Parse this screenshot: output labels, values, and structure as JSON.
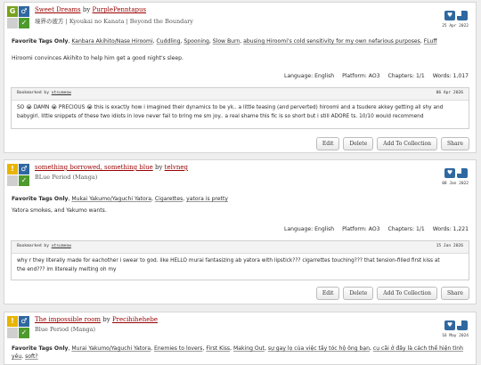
{
  "colors": {
    "rating_general": "#77a11e",
    "warning_yellow": "#e8b400",
    "category_blue": "#2f68a0",
    "complete_green": "#4e9b2d",
    "tr_blank": "#cfcfcf",
    "link": "#990000"
  },
  "works": [
    {
      "title": "Sweet Dreams",
      "by": "by",
      "author": "PurplePenntapus",
      "fandoms": "境界の彼方 | Kyoukai no Kanata | Beyond the Boundary",
      "date": "25 Apr 2022",
      "rating_symbol": "G",
      "category_symbol": "♂",
      "tags_label": "Favorite Tags Only",
      "tags": [
        "Kanbara Akihito/Nase Hiroomi",
        "Cuddling",
        "Spooning",
        "Slow Burn",
        "abusing Hiroomi's cold sensitivity for my own nefarious purposes",
        "FLuff"
      ],
      "summary": "Hiroomi convinces Akihito to help him get a good night's sleep.",
      "stats": {
        "language": "Language: English",
        "platform": "Platform: AO3",
        "chapters": "Chapters: 1/1",
        "words": "Words: 1,017"
      },
      "bookmark": {
        "label": "Bookmarked by",
        "user": "utsumeow",
        "date": "06 Apr 2026",
        "note_lines": [
          "SO 😭 DAMN 😭 PRECIOUS 😭 this is exactly how i imagined their dynamics to be yk.. a little teasing (and perverted) hiroomi and a tsudere akkey getting all shy and",
          "babygirl. little snippets of these two idiots in love never fail to bring me sm joy.. a real shame this fic is so short but i still ADORE ts. 10/10 would recommend"
        ]
      }
    },
    {
      "title": "something borrowed, something blue",
      "by": "by",
      "author": "telvneg",
      "fandoms": "BLue Period (Manga)",
      "date": "08 Jan 2022",
      "rating_symbol": "!",
      "category_symbol": "♂",
      "tags_label": "Favorite Tags Only",
      "tags": [
        "Mukai Yakumo/Yaguchi Yatora",
        "Cigarettes",
        "yatora is pretty"
      ],
      "summary": "Yatora smokes, and Yakumo wants.",
      "stats": {
        "language": "Language: English",
        "platform": "Platform: AO3",
        "chapters": "Chapters: 1/1",
        "words": "Words: 1,221"
      },
      "bookmark": {
        "label": "Bookmarked by",
        "user": "utsumeow",
        "date": "15 Jan 2026",
        "note_lines": [
          "why r they literally made for eachother i swear to god. like HELLO murai fantasizing ab yatora with lipstick??? cigarrettes touching??? that tension-filled first kiss at",
          "the end??? im litereally melting oh my"
        ]
      }
    },
    {
      "title": "The impossible room",
      "by": "by",
      "author": "Precihihehebe",
      "fandoms": "Blue Period (Manga)",
      "date": "16 May 2024",
      "rating_symbol": "!",
      "category_symbol": "♂",
      "tags_label": "Favorite Tags Only",
      "tags": [
        "Murai Yakumo/Yaguchi Yatora",
        "Enemies to lovers",
        "First Kiss",
        "Making Out",
        "sự gay lọ của việc tấy tóc hộ ông bạn",
        "cụ cãi ở đây là cách thể hiện tình yêu",
        "soft?"
      ]
    }
  ],
  "buttons": {
    "edit": "Edit",
    "delete": "Delete",
    "add_collection": "Add To Collection",
    "share": "Share"
  }
}
